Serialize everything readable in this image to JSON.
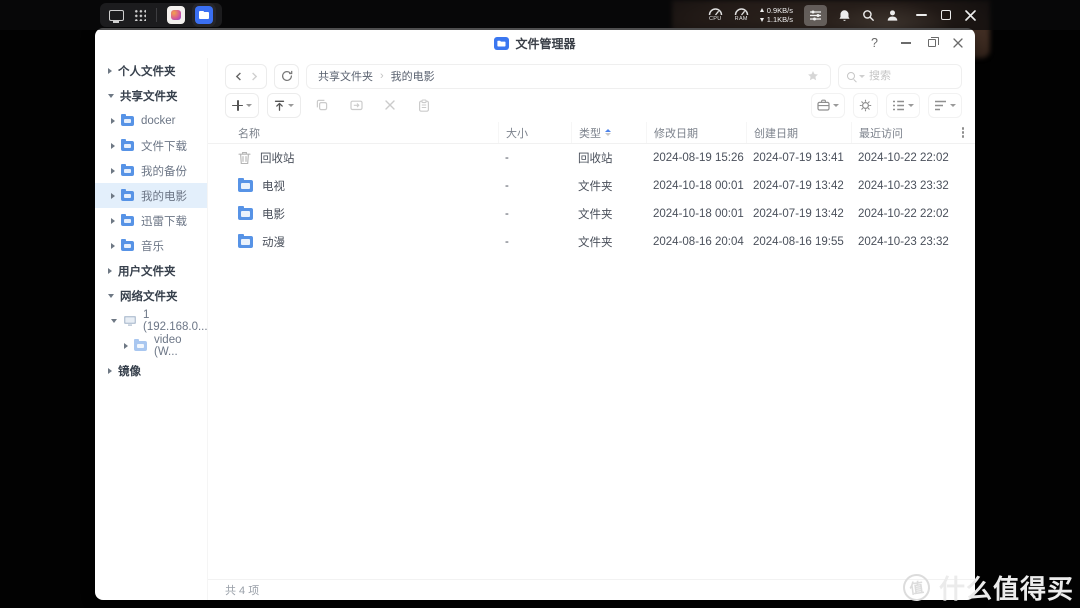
{
  "topbar": {
    "system": {
      "cpu_label": "CPU",
      "ram_label": "RAM",
      "net_up": "0.9KB/s",
      "net_down": "1.1KB/s"
    },
    "left_icons": [
      "desktop-icon",
      "apps-grid-icon",
      "app-store-icon",
      "file-manager-icon"
    ],
    "right_icons": [
      "mixer-icon",
      "bell-icon",
      "search-icon",
      "user-icon"
    ],
    "window_buttons": [
      "minimize",
      "maximize",
      "close"
    ]
  },
  "window": {
    "title": "文件管理器",
    "help_label": "?"
  },
  "sidebar": {
    "items": [
      {
        "label": "个人文件夹",
        "level": 0,
        "state": "collapsed"
      },
      {
        "label": "共享文件夹",
        "level": 0,
        "state": "expanded"
      },
      {
        "label": "docker",
        "level": 1,
        "icon": "folder-icon",
        "state": "collapsed"
      },
      {
        "label": "文件下载",
        "level": 1,
        "icon": "folder-icon",
        "state": "collapsed"
      },
      {
        "label": "我的备份",
        "level": 1,
        "icon": "folder-icon",
        "state": "collapsed"
      },
      {
        "label": "我的电影",
        "level": 1,
        "icon": "folder-icon",
        "state": "collapsed",
        "selected": true
      },
      {
        "label": "迅雷下载",
        "level": 1,
        "icon": "folder-icon",
        "state": "collapsed"
      },
      {
        "label": "音乐",
        "level": 1,
        "icon": "folder-icon",
        "state": "collapsed"
      },
      {
        "label": "用户文件夹",
        "level": 0,
        "state": "collapsed"
      },
      {
        "label": "网络文件夹",
        "level": 0,
        "state": "expanded"
      },
      {
        "label": "1 (192.168.0...",
        "level": 1,
        "icon": "monitor-icon",
        "state": "expanded"
      },
      {
        "label": "video (W...",
        "level": 2,
        "icon": "folder-light-icon",
        "state": "collapsed"
      },
      {
        "label": "镜像",
        "level": 0,
        "state": "collapsed"
      }
    ]
  },
  "nav": {
    "breadcrumb": {
      "segments": [
        "共享文件夹",
        "我的电影"
      ],
      "separator": "›"
    },
    "search_placeholder": "搜索"
  },
  "toolbar": {
    "left": [
      {
        "name": "new",
        "icon": "plus-icon",
        "caret": true,
        "enabled": true
      },
      {
        "name": "upload",
        "icon": "upload-icon",
        "caret": true,
        "enabled": true
      },
      {
        "name": "copy",
        "icon": "copy-icon",
        "enabled": false
      },
      {
        "name": "move",
        "icon": "move-icon",
        "enabled": false
      },
      {
        "name": "delete",
        "icon": "delete-icon",
        "enabled": false
      },
      {
        "name": "paste",
        "icon": "paste-icon",
        "enabled": false
      }
    ],
    "right": [
      {
        "name": "tasks",
        "icon": "briefcase-icon",
        "caret": true
      },
      {
        "name": "settings",
        "icon": "gear-icon",
        "caret": false
      },
      {
        "name": "view-mode",
        "icon": "list-view-icon",
        "caret": true
      },
      {
        "name": "sort",
        "icon": "sort-lines-icon",
        "caret": true
      }
    ]
  },
  "table": {
    "columns": {
      "name": "名称",
      "size": "大小",
      "type": "类型",
      "modified": "修改日期",
      "created": "创建日期",
      "accessed": "最近访问"
    },
    "sorted_by": "类型",
    "sort_direction": "asc",
    "rows": [
      {
        "icon": "trash-icon",
        "name": "回收站",
        "size": "-",
        "type": "回收站",
        "modified": "2024-08-19 15:26",
        "created": "2024-07-19 13:41",
        "accessed": "2024-10-22 22:02"
      },
      {
        "icon": "folder-icon",
        "name": "电视",
        "size": "-",
        "type": "文件夹",
        "modified": "2024-10-18 00:01",
        "created": "2024-07-19 13:42",
        "accessed": "2024-10-23 23:32"
      },
      {
        "icon": "folder-icon",
        "name": "电影",
        "size": "-",
        "type": "文件夹",
        "modified": "2024-10-18 00:01",
        "created": "2024-07-19 13:42",
        "accessed": "2024-10-22 22:02"
      },
      {
        "icon": "folder-icon",
        "name": "动漫",
        "size": "-",
        "type": "文件夹",
        "modified": "2024-08-16 20:04",
        "created": "2024-08-16 19:55",
        "accessed": "2024-10-23 23:32"
      }
    ]
  },
  "statusbar": {
    "summary": "共 4 项"
  },
  "watermark": {
    "logo": "值",
    "brand": "什么值得买"
  }
}
